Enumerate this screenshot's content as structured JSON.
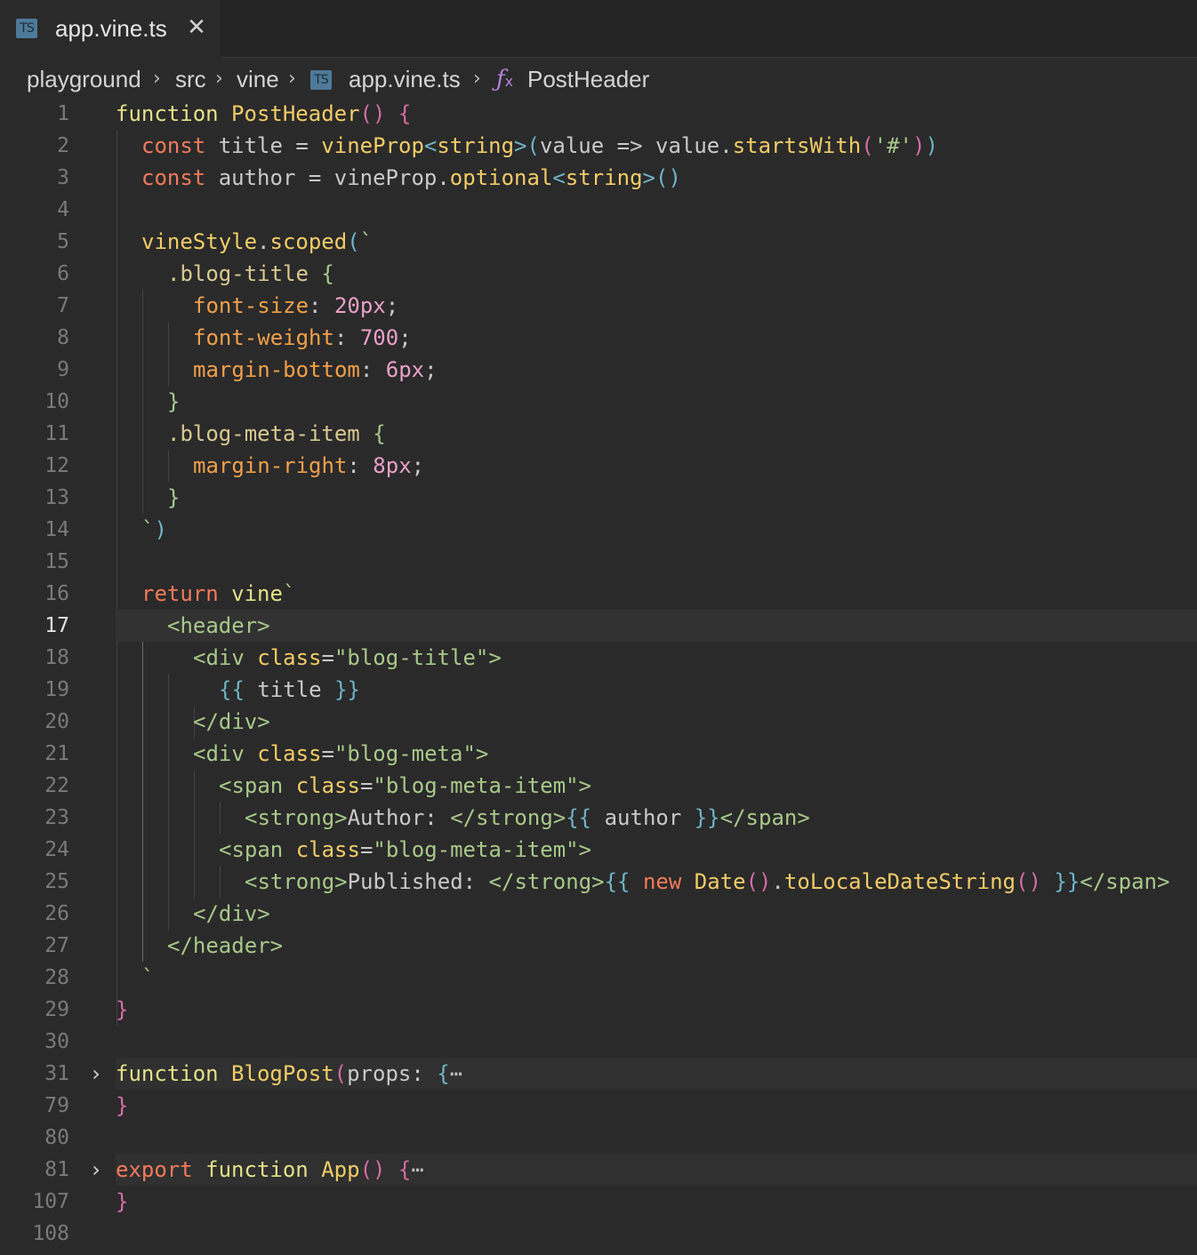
{
  "tab": {
    "badge": "TS",
    "filename": "app.vine.ts",
    "close_glyph": "✕"
  },
  "breadcrumb": {
    "items": [
      "playground",
      "src",
      "vine"
    ],
    "file_badge": "TS",
    "file": "app.vine.ts",
    "symbol_icon": "fx-icon",
    "symbol": "PostHeader",
    "separator": "›"
  },
  "editor": {
    "active_line": "17",
    "lines": [
      {
        "n": "1"
      },
      {
        "n": "2"
      },
      {
        "n": "3"
      },
      {
        "n": "4"
      },
      {
        "n": "5"
      },
      {
        "n": "6"
      },
      {
        "n": "7"
      },
      {
        "n": "8"
      },
      {
        "n": "9"
      },
      {
        "n": "10"
      },
      {
        "n": "11"
      },
      {
        "n": "12"
      },
      {
        "n": "13"
      },
      {
        "n": "14"
      },
      {
        "n": "15"
      },
      {
        "n": "16"
      },
      {
        "n": "17"
      },
      {
        "n": "18"
      },
      {
        "n": "19"
      },
      {
        "n": "20"
      },
      {
        "n": "21"
      },
      {
        "n": "22"
      },
      {
        "n": "23"
      },
      {
        "n": "24"
      },
      {
        "n": "25"
      },
      {
        "n": "26"
      },
      {
        "n": "27"
      },
      {
        "n": "28"
      },
      {
        "n": "29"
      },
      {
        "n": "30"
      },
      {
        "n": "31"
      },
      {
        "n": "79"
      },
      {
        "n": "80"
      },
      {
        "n": "81"
      },
      {
        "n": "107"
      },
      {
        "n": "108"
      }
    ],
    "code": {
      "l1": [
        "function",
        " ",
        "PostHeader",
        "()",
        " ",
        "{"
      ],
      "l2": [
        "const",
        " title = ",
        "vineProp",
        "<",
        "string",
        ">",
        "(",
        "value => value.",
        "startsWith",
        "(",
        "'#'",
        ")",
        ")"
      ],
      "l3": [
        "const",
        " author = vineProp.",
        "optional",
        "<",
        "string",
        ">",
        "()"
      ],
      "l5": [
        "vineStyle",
        ".",
        "scoped",
        "(",
        "`"
      ],
      "l6": [
        ".blog-title",
        " ",
        "{"
      ],
      "l7": [
        "font-size",
        ": ",
        "20px",
        ";"
      ],
      "l8": [
        "font-weight",
        ": ",
        "700",
        ";"
      ],
      "l9": [
        "margin-bottom",
        ": ",
        "6px",
        ";"
      ],
      "l10": [
        "}"
      ],
      "l11": [
        ".blog-meta-item",
        " ",
        "{"
      ],
      "l12": [
        "margin-right",
        ": ",
        "8px",
        ";"
      ],
      "l13": [
        "}"
      ],
      "l14": [
        "`",
        ")"
      ],
      "l16": [
        "return",
        " ",
        "vine",
        "`"
      ],
      "l17": [
        "<header>"
      ],
      "l18": [
        "<div ",
        "class",
        "=",
        "\"blog-title\"",
        ">"
      ],
      "l19": [
        "{{",
        " title ",
        "}}"
      ],
      "l20": [
        "</div>"
      ],
      "l21": [
        "<div ",
        "class",
        "=",
        "\"blog-meta\"",
        ">"
      ],
      "l22": [
        "<span ",
        "class",
        "=",
        "\"blog-meta-item\"",
        ">"
      ],
      "l23": [
        "<strong>",
        "Author: ",
        "</strong>",
        "{{",
        " author ",
        "}}",
        "</span>"
      ],
      "l24": [
        "<span ",
        "class",
        "=",
        "\"blog-meta-item\"",
        ">"
      ],
      "l25": [
        "<strong>",
        "Published: ",
        "</strong>",
        "{{",
        " ",
        "new",
        " ",
        "Date",
        "()",
        ".",
        "toLocaleDateString",
        "()",
        " ",
        "}}",
        "</span>"
      ],
      "l26": [
        "</div>"
      ],
      "l27": [
        "</header>"
      ],
      "l28": [
        "`"
      ],
      "l29": [
        "}"
      ],
      "l31": [
        "function",
        " ",
        "BlogPost",
        "(",
        "props: ",
        "{",
        "⋯"
      ],
      "l79": [
        "}"
      ],
      "l81": [
        "export",
        " ",
        "function",
        " ",
        "App",
        "()",
        " ",
        "{",
        "⋯"
      ],
      "l107": [
        "}"
      ]
    },
    "fold_glyph": "›"
  },
  "colors": {
    "background": "#2a2a2a",
    "keyword": "#e3e08a",
    "keyword_control": "#f47a5b",
    "function": "#f2cc67",
    "string": "#a8c88a",
    "css_property": "#f0a04a",
    "number": "#e8a0c8",
    "ts_badge": "#4e7a9a",
    "fx_icon": "#b083d8"
  }
}
